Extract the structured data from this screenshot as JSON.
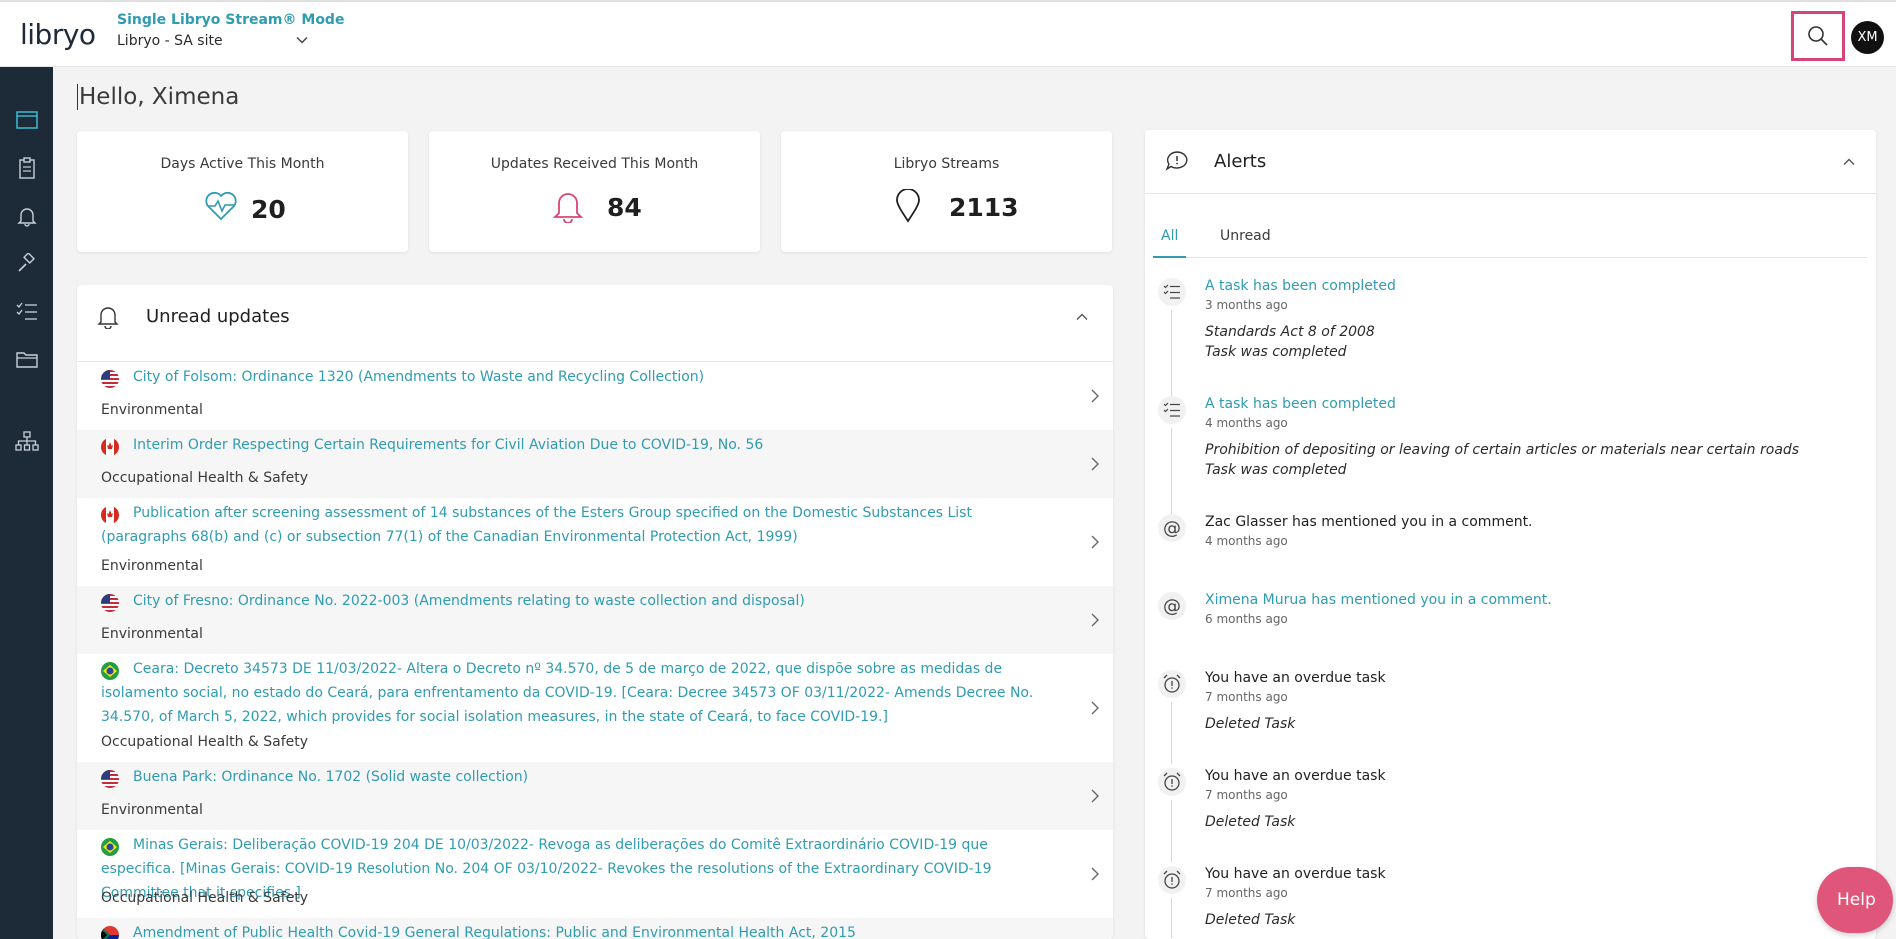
{
  "header": {
    "logo": "libryo",
    "mode_title": "Single Libryo Stream® Mode",
    "stream_selected": "Libryo - SA site",
    "avatar_initials": "XM"
  },
  "sidebar": {
    "items": [
      "browser-window-icon",
      "clipboard-icon",
      "bell-icon",
      "gavel-icon",
      "checklist-icon",
      "folder-icon",
      "org-chart-icon"
    ]
  },
  "greeting": "Hello, Ximena",
  "stats": [
    {
      "label": "Days Active This Month",
      "value": "20",
      "icon": "heartbeat-icon"
    },
    {
      "label": "Updates Received This Month",
      "value": "84",
      "icon": "bell-icon"
    },
    {
      "label": "Libryo Streams",
      "value": "2113",
      "icon": "map-pin-icon"
    }
  ],
  "updates": {
    "title": "Unread updates",
    "rows": [
      {
        "flag": "us",
        "title": "City of Folsom: Ordinance 1320 (Amendments to Waste and Recycling Collection)",
        "category": "Environmental"
      },
      {
        "flag": "ca",
        "title": "Interim Order Respecting Certain Requirements for Civil Aviation Due to COVID-19, No. 56",
        "category": "Occupational Health & Safety"
      },
      {
        "flag": "ca",
        "title": "Publication after screening assessment of 14 substances of the Esters Group specified on the Domestic Substances List (paragraphs 68(b) and (c) or subsection 77(1) of the Canadian Environmental Protection Act, 1999)",
        "category": "Environmental"
      },
      {
        "flag": "us",
        "title": "City of Fresno: Ordinance No. 2022-003 (Amendments relating to waste collection and disposal)",
        "category": "Environmental"
      },
      {
        "flag": "br",
        "title": "Ceara: Decreto 34573 DE 11/03/2022- Altera o Decreto nº 34.570, de 5 de março de 2022, que dispõe sobre as medidas de isolamento social, no estado do Ceará, para enfrentamento da COVID-19. [Ceara: Decree 34573 OF 03/11/2022- Amends Decree No. 34.570, of March 5, 2022, which provides for social isolation measures, in the state of Ceará, to face COVID-19.]",
        "category": "Occupational Health & Safety"
      },
      {
        "flag": "us",
        "title": "Buena Park: Ordinance No. 1702 (Solid waste collection)",
        "category": "Environmental"
      },
      {
        "flag": "br",
        "title": "Minas Gerais: Deliberação COVID-19 204 DE 10/03/2022- Revoga as deliberações do Comitê Extraordinário COVID-19 que especifica. [Minas Gerais: COVID-19 Resolution No. 204 OF 03/10/2022- Revokes the resolutions of the Extraordinary COVID-19 Committee that it specifies.]",
        "category": "Occupational Health & Safety"
      },
      {
        "flag": "za",
        "title": "Amendment of Public Health Covid-19 General Regulations: Public and Environmental Health Act, 2015",
        "category": ""
      }
    ]
  },
  "alerts": {
    "title": "Alerts",
    "tabs": [
      "All",
      "Unread"
    ],
    "items": [
      {
        "icon": "task-list-icon",
        "title": "A task has been completed",
        "link": true,
        "ago": "3 months ago",
        "desc1": "Standards Act 8 of 2008",
        "desc2": "Task was completed"
      },
      {
        "icon": "task-list-icon",
        "title": "A task has been completed",
        "link": true,
        "ago": "4 months ago",
        "desc1": "Prohibition of depositing or leaving of certain articles or materials near certain roads",
        "desc2": "Task was completed"
      },
      {
        "icon": "at-sign-icon",
        "title": "Zac Glasser has mentioned you in a comment.",
        "link": false,
        "ago": "4 months ago",
        "desc1": "",
        "desc2": ""
      },
      {
        "icon": "at-sign-icon",
        "title": "Ximena Murua has mentioned you in a comment.",
        "link": true,
        "ago": "6 months ago",
        "desc1": "",
        "desc2": ""
      },
      {
        "icon": "alarm-clock-icon",
        "title": "You have an overdue task",
        "link": false,
        "ago": "7 months ago",
        "desc1": "Deleted Task",
        "desc2": ""
      },
      {
        "icon": "alarm-clock-icon",
        "title": "You have an overdue task",
        "link": false,
        "ago": "7 months ago",
        "desc1": "Deleted Task",
        "desc2": ""
      },
      {
        "icon": "alarm-clock-icon",
        "title": "You have an overdue task",
        "link": false,
        "ago": "7 months ago",
        "desc1": "Deleted Task",
        "desc2": ""
      }
    ]
  },
  "help_label": "Help",
  "colors": {
    "accent": "#2f9cb0",
    "sidebar": "#1d2a38",
    "help": "#e0567a",
    "alert_red": "#d6457a"
  }
}
